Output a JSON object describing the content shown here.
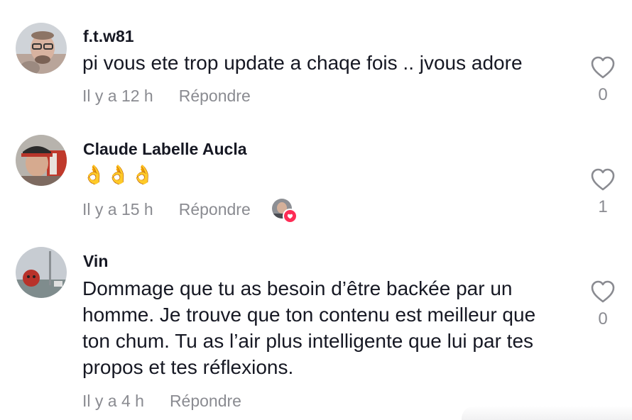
{
  "comments": [
    {
      "username": "f.t.w81",
      "text": "pi vous ete trop update a chaqe fois .. jvous adore",
      "time": "Il y a 12 h",
      "reply_label": "Répondre",
      "like_count": "0",
      "icon": "heart-outline-icon"
    },
    {
      "username": "Claude Labelle Aucla",
      "text": "👌👌👌",
      "time": "Il y a 15 h",
      "reply_label": "Répondre",
      "like_count": "1",
      "icon": "heart-outline-icon",
      "creator_liked": true
    },
    {
      "username": "Vin",
      "text": "Dommage que tu as besoin d’être backée par un homme. Je trouve que ton contenu est meilleur que ton chum. Tu as l’air plus intelligente que lui par tes propos et tes réflexions.",
      "time": "Il y a 4 h",
      "reply_label": "Répondre",
      "like_count": "0",
      "icon": "heart-outline-icon"
    }
  ],
  "colors": {
    "text": "#161823",
    "muted": "#8a8b91",
    "accent": "#fe2c55"
  }
}
